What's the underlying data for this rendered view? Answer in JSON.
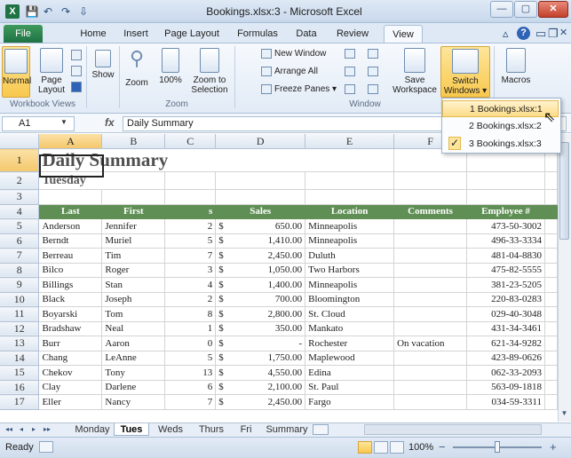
{
  "window": {
    "title": "Bookings.xlsx:3 - Microsoft Excel",
    "app_icon_letter": "X",
    "minimize": "—",
    "restore": "▢",
    "close": "✕"
  },
  "ribbon": {
    "tabs": [
      "File",
      "Home",
      "Insert",
      "Page Layout",
      "Formulas",
      "Data",
      "Review",
      "View"
    ],
    "groups": {
      "workbook_views": {
        "label": "Workbook Views",
        "normal": "Normal",
        "page_layout": "Page Layout"
      },
      "show": "Show",
      "zoom": {
        "label": "Zoom",
        "zoom": "Zoom",
        "pct": "100%",
        "to_selection": "Zoom to Selection"
      },
      "window": {
        "label": "Window",
        "new_window": "New Window",
        "arrange_all": "Arrange All",
        "freeze_panes": "Freeze Panes ▾",
        "save_workspace": "Save Workspace",
        "switch_windows": "Switch Windows ▾"
      },
      "macros": "Macros"
    }
  },
  "switch_menu": {
    "items": [
      {
        "label": "1 Bookings.xlsx:1",
        "highlighted": true,
        "checked": false
      },
      {
        "label": "2 Bookings.xlsx:2",
        "highlighted": false,
        "checked": false
      },
      {
        "label": "3 Bookings.xlsx:3",
        "highlighted": false,
        "checked": true
      }
    ],
    "check": "✓"
  },
  "formula_bar": {
    "name_box": "A1",
    "fx": "fx",
    "value": "Daily Summary"
  },
  "grid": {
    "columns": [
      "A",
      "B",
      "C",
      "D",
      "E",
      "F",
      "G"
    ],
    "title": "Daily Summary",
    "subtitle": "Tuesday",
    "headers": [
      "Last",
      "First",
      "s",
      "Sales",
      "Location",
      "Comments",
      "Employee #"
    ],
    "rows": [
      {
        "n": "5",
        "last": "Anderson",
        "first": "Jennifer",
        "s": "2",
        "cur": "$",
        "sales": "650.00",
        "loc": "Minneapolis",
        "comments": "",
        "emp": "473-50-3002"
      },
      {
        "n": "6",
        "last": "Berndt",
        "first": "Muriel",
        "s": "5",
        "cur": "$",
        "sales": "1,410.00",
        "loc": "Minneapolis",
        "comments": "",
        "emp": "496-33-3334"
      },
      {
        "n": "7",
        "last": "Berreau",
        "first": "Tim",
        "s": "7",
        "cur": "$",
        "sales": "2,450.00",
        "loc": "Duluth",
        "comments": "",
        "emp": "481-04-8830"
      },
      {
        "n": "8",
        "last": "Bilco",
        "first": "Roger",
        "s": "3",
        "cur": "$",
        "sales": "1,050.00",
        "loc": "Two Harbors",
        "comments": "",
        "emp": "475-82-5555"
      },
      {
        "n": "9",
        "last": "Billings",
        "first": "Stan",
        "s": "4",
        "cur": "$",
        "sales": "1,400.00",
        "loc": "Minneapolis",
        "comments": "",
        "emp": "381-23-5205"
      },
      {
        "n": "10",
        "last": "Black",
        "first": "Joseph",
        "s": "2",
        "cur": "$",
        "sales": "700.00",
        "loc": "Bloomington",
        "comments": "",
        "emp": "220-83-0283"
      },
      {
        "n": "11",
        "last": "Boyarski",
        "first": "Tom",
        "s": "8",
        "cur": "$",
        "sales": "2,800.00",
        "loc": "St. Cloud",
        "comments": "",
        "emp": "029-40-3048"
      },
      {
        "n": "12",
        "last": "Bradshaw",
        "first": "Neal",
        "s": "1",
        "cur": "$",
        "sales": "350.00",
        "loc": "Mankato",
        "comments": "",
        "emp": "431-34-3461"
      },
      {
        "n": "13",
        "last": "Burr",
        "first": "Aaron",
        "s": "0",
        "cur": "$",
        "sales": "-",
        "loc": "Rochester",
        "comments": "On vacation",
        "emp": "621-34-9282"
      },
      {
        "n": "14",
        "last": "Chang",
        "first": "LeAnne",
        "s": "5",
        "cur": "$",
        "sales": "1,750.00",
        "loc": "Maplewood",
        "comments": "",
        "emp": "423-89-0626"
      },
      {
        "n": "15",
        "last": "Chekov",
        "first": "Tony",
        "s": "13",
        "cur": "$",
        "sales": "4,550.00",
        "loc": "Edina",
        "comments": "",
        "emp": "062-33-2093"
      },
      {
        "n": "16",
        "last": "Clay",
        "first": "Darlene",
        "s": "6",
        "cur": "$",
        "sales": "2,100.00",
        "loc": "St. Paul",
        "comments": "",
        "emp": "563-09-1818"
      },
      {
        "n": "17",
        "last": "Eller",
        "first": "Nancy",
        "s": "7",
        "cur": "$",
        "sales": "2,450.00",
        "loc": "Fargo",
        "comments": "",
        "emp": "034-59-3311"
      }
    ]
  },
  "sheets": {
    "nav": [
      "◂◂",
      "◂",
      "▸",
      "▸▸"
    ],
    "tabs": [
      "Monday",
      "Tues",
      "Weds",
      "Thurs",
      "Fri",
      "Summary"
    ]
  },
  "status": {
    "ready": "Ready",
    "zoom": "100%",
    "minus": "−",
    "plus": "+"
  }
}
